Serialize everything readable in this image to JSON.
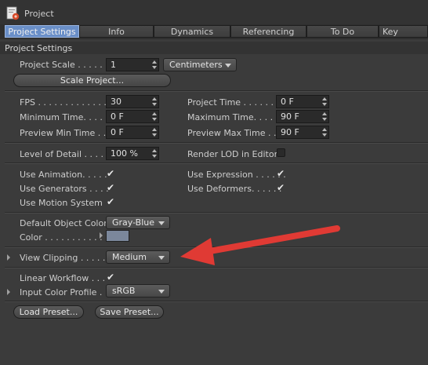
{
  "window": {
    "title": "Project"
  },
  "tabs": [
    {
      "label": "Project Settings"
    },
    {
      "label": "Info"
    },
    {
      "label": "Dynamics"
    },
    {
      "label": "Referencing"
    },
    {
      "label": "To Do"
    },
    {
      "label": "Key Interpo"
    }
  ],
  "section": {
    "title": "Project Settings"
  },
  "project_scale": {
    "label": "Project Scale . . . . . .",
    "value": "1",
    "unit": "Centimeters"
  },
  "scale_project_button": "Scale Project...",
  "fps": {
    "label": "FPS . . . . . . . . . . . . .",
    "value": "30"
  },
  "project_time": {
    "label": "Project Time . . . . . . . .",
    "value": "0 F"
  },
  "minimum_time": {
    "label": "Minimum Time. . . . . . .",
    "value": "0 F"
  },
  "maximum_time": {
    "label": "Maximum Time. . . . . . .",
    "value": "90 F"
  },
  "preview_min_time": {
    "label": "Preview Min Time . . .",
    "value": "0 F"
  },
  "preview_max_time": {
    "label": "Preview Max Time . . . .",
    "value": "90 F"
  },
  "level_of_detail": {
    "label": "Level of Detail . . . . .",
    "value": "100 %"
  },
  "render_lod": {
    "label": "Render LOD in Editor",
    "checked": false
  },
  "use_animation": {
    "label": "Use Animation. . . . .",
    "checked": true
  },
  "use_expression": {
    "label": "Use Expression . . . . . .",
    "checked": true
  },
  "use_generators": {
    "label": "Use Generators . . . .",
    "checked": true
  },
  "use_deformers": {
    "label": "Use Deformers. . . . . .",
    "checked": true
  },
  "use_motion_system": {
    "label": "Use Motion System",
    "checked": true
  },
  "default_object_color": {
    "label": "Default Object Color",
    "value": "Gray-Blue"
  },
  "color": {
    "label": "Color . . . . . . . . . . .",
    "swatch": "#7b879b"
  },
  "view_clipping": {
    "label": "View Clipping . . . . . .",
    "value": "Medium"
  },
  "linear_workflow": {
    "label": "Linear Workflow . . .",
    "checked": true
  },
  "input_color_profile": {
    "label": "Input Color Profile . .",
    "value": "sRGB"
  },
  "load_preset_button": "Load Preset...",
  "save_preset_button": "Save Preset...",
  "check_glyph": "✔",
  "colors": {
    "accent_tab": "#6a8fc8",
    "annotation_arrow": "#e03a34"
  }
}
